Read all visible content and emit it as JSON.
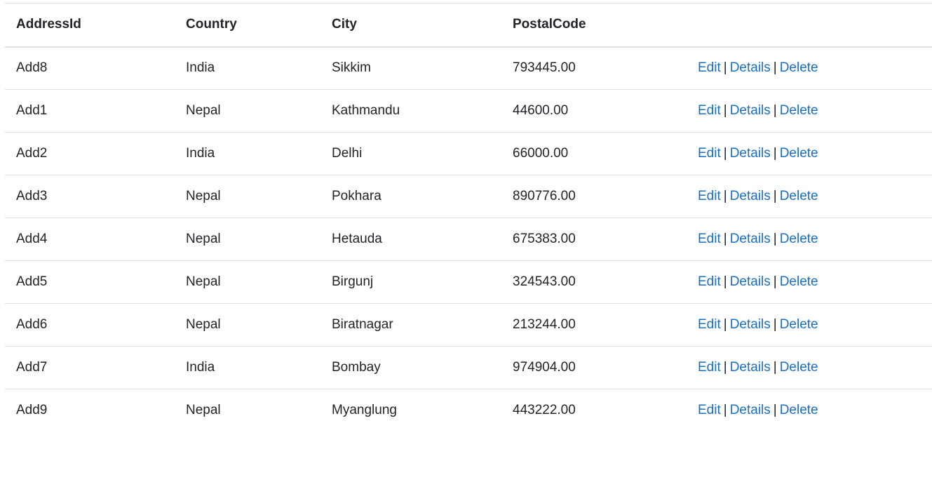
{
  "table": {
    "headers": [
      "AddressId",
      "Country",
      "City",
      "PostalCode",
      ""
    ],
    "action_labels": {
      "edit": "Edit",
      "details": "Details",
      "delete": "Delete",
      "separator": "|"
    },
    "rows": [
      {
        "address_id": "Add8",
        "country": "India",
        "city": "Sikkim",
        "postal_code": "793445.00"
      },
      {
        "address_id": "Add1",
        "country": "Nepal",
        "city": "Kathmandu",
        "postal_code": "44600.00"
      },
      {
        "address_id": "Add2",
        "country": "India",
        "city": "Delhi",
        "postal_code": "66000.00"
      },
      {
        "address_id": "Add3",
        "country": "Nepal",
        "city": "Pokhara",
        "postal_code": "890776.00"
      },
      {
        "address_id": "Add4",
        "country": "Nepal",
        "city": "Hetauda",
        "postal_code": "675383.00"
      },
      {
        "address_id": "Add5",
        "country": "Nepal",
        "city": "Birgunj",
        "postal_code": "324543.00"
      },
      {
        "address_id": "Add6",
        "country": "Nepal",
        "city": "Biratnagar",
        "postal_code": "213244.00"
      },
      {
        "address_id": "Add7",
        "country": "India",
        "city": "Bombay",
        "postal_code": "974904.00"
      },
      {
        "address_id": "Add9",
        "country": "Nepal",
        "city": "Myanglung",
        "postal_code": "443222.00"
      }
    ]
  },
  "colors": {
    "text": "#212529",
    "link": "#1b6ec2",
    "border": "#dee2e6"
  }
}
